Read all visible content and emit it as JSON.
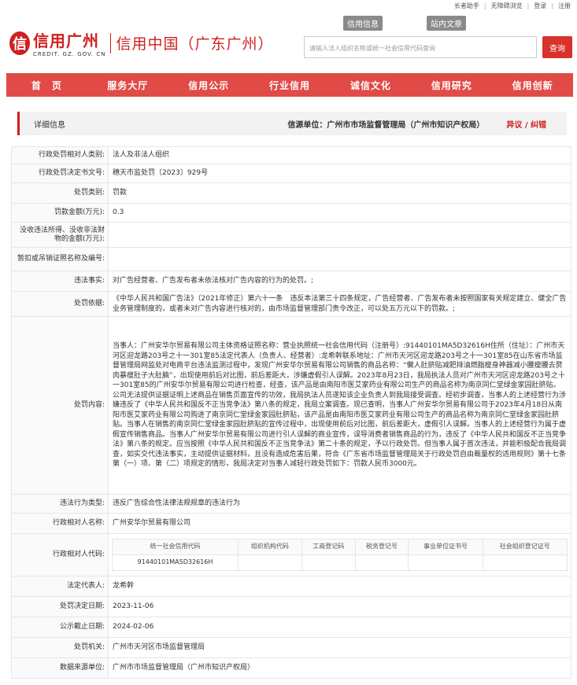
{
  "topbar": {
    "links": [
      "长者助手",
      "无障碍浏览",
      "登录",
      "注册"
    ]
  },
  "logo": {
    "mark": "信",
    "cn": "信用广州",
    "en": "CREDIT. GZ. GOV. CN"
  },
  "site_name": "信用中国（广东广州）",
  "quick_tabs": [
    "信用信息",
    "站内文章"
  ],
  "search": {
    "placeholder": "请输入法人组织名称或统一社会信用代码查询",
    "button": "查询"
  },
  "nav": [
    "首　页",
    "服务大厅",
    "信用公示",
    "行业信用",
    "诚信文化",
    "信用研究",
    "信用创新"
  ],
  "detail": {
    "title": "详细信息",
    "source_label": "信源单位：",
    "source": "广州市市场监督管理局（广州市知识产权局）",
    "objection": "异议 / 纠错"
  },
  "rows": [
    {
      "label": "行政处罚相对人类别:",
      "value": "法人及非法人组织"
    },
    {
      "label": "行政处罚决定书文号:",
      "value": "穗天市监处罚〔2023〕929号"
    },
    {
      "label": "处罚类别:",
      "value": "罚款"
    },
    {
      "label": "罚款金额(万元):",
      "value": "0.3"
    },
    {
      "label": "没收违法所得、没收非法财物的金额(万元):",
      "value": ""
    },
    {
      "label": "暂扣或吊销证照名称及编号:",
      "value": ""
    },
    {
      "label": "违法事实:",
      "value": "对广告经营者、广告发布者未依法核对广告内容的行为的处罚。;"
    },
    {
      "label": "处罚依据:",
      "value": "《中华人民共和国广告法》（2021年修正）第六十一条　违反本法第三十四条规定，广告经营者、广告发布者未按照国家有关规定建立、健全广告业务管理制度的，或者未对广告内容进行核对的，由市场监督管理部门责令改正，可以处五万元以下的罚款。;"
    },
    {
      "label": "处罚内容:",
      "value": "当事人：广州安华尔贸易有限公司主体资格证照名称：营业执照统一社会信用代码（注册号）:91440101MA5D32616H住所（住址）：广州市天河区迎龙路203号之十一301室85法定代表人（负责人、经营者）:龙希幹联系地址：广州市天河区迎龙路203号之十一301室85在山东省市场监督管理局网监处对电商平台违法监测过程中，发现广州安华尔贸易有限公司销售的商品名称：“懒人肚脐贴减肥排油燃脂瘦身神器减小腰瘦腰去赘肉暴瘦肚子大肚腩”，出现使用前后对比图，前后差距大，涉嫌虚假引人误解。2023年8月23日，我局执法人员对广州市天河区迎龙路203号之十一301室85的广州安华尔贸易有限公司进行检查，经查，该产品是由南阳市医艾家药业有限公司生产的商品名称为南京同仁堂绿金家园肚脐贴。公司无法提供证据证明上述商品在销售页面宣传的功效，我局执法人员遂知该企业负责人到我局接受调查。经初步调查，当事人的上述经营行为涉嫌违反了《中华人民共和国反不正当竞争法》第八条的规定，我局立案调查。现已查明，当事人广州安华尔贸易有限公司于2023年4月18日从南阳市医艾家药业有限公司购进了南京同仁堂绿金家园肚脐贴，该产品是由南阳市医艾家药业有限公司生产的商品名称为南京同仁堂绿金家园肚脐贴。当事人在销售的南京同仁堂绿金家园肚脐贴的宣传过程中，出现使用前后对比图，前后差距大，虚假引人误解。当事人的上述经营行为属于虚假宣传销售商品。当事人广州安华尔贸易有限公司进行引人误解的商业宣传，误导消费者销售商品的行为，违反了《中华人民共和国反不正当竞争法》第八条的规定。应当按照《中华人民共和国反不正当竞争法》第二十条的规定，予以行政处罚。但当事人属于首次违法，并能积极配合我局调查，如实交代违法事实，主动提供证据材料，且没有造成危害后果，符合《广东省市场监督管理局关于行政处罚自由裁量权的适用规则》第十七条第（一）项、第（二）项规定的情形，我局决定对当事人减轻行政处罚如下：罚款人民币3000元。"
    },
    {
      "label": "违法行为类型:",
      "value": "违反广告综合性法律法规规章的违法行为"
    },
    {
      "label": "行政相对人名称:",
      "value": "广州安华尔贸易有限公司"
    }
  ],
  "codes": {
    "label": "行政相对人代码:",
    "headers": [
      "统一社会信用代码",
      "组织机构代码",
      "工商登记码",
      "税务登记号",
      "事业单位证书号",
      "社会组织登记证号"
    ],
    "values": [
      "91440101MA5D32616H",
      "",
      "",
      "",
      "",
      ""
    ]
  },
  "rows2": [
    {
      "label": "法定代表人:",
      "value": "龙希幹"
    },
    {
      "label": "处罚决定日期:",
      "value": "2023-11-06"
    },
    {
      "label": "公示截止日期:",
      "value": "2024-02-06"
    },
    {
      "label": "处罚机关:",
      "value": "广州市天河区市场监督管理局"
    },
    {
      "label": "数据来源单位:",
      "value": "广州市市场监督管理局（广州市知识产权局）"
    }
  ]
}
